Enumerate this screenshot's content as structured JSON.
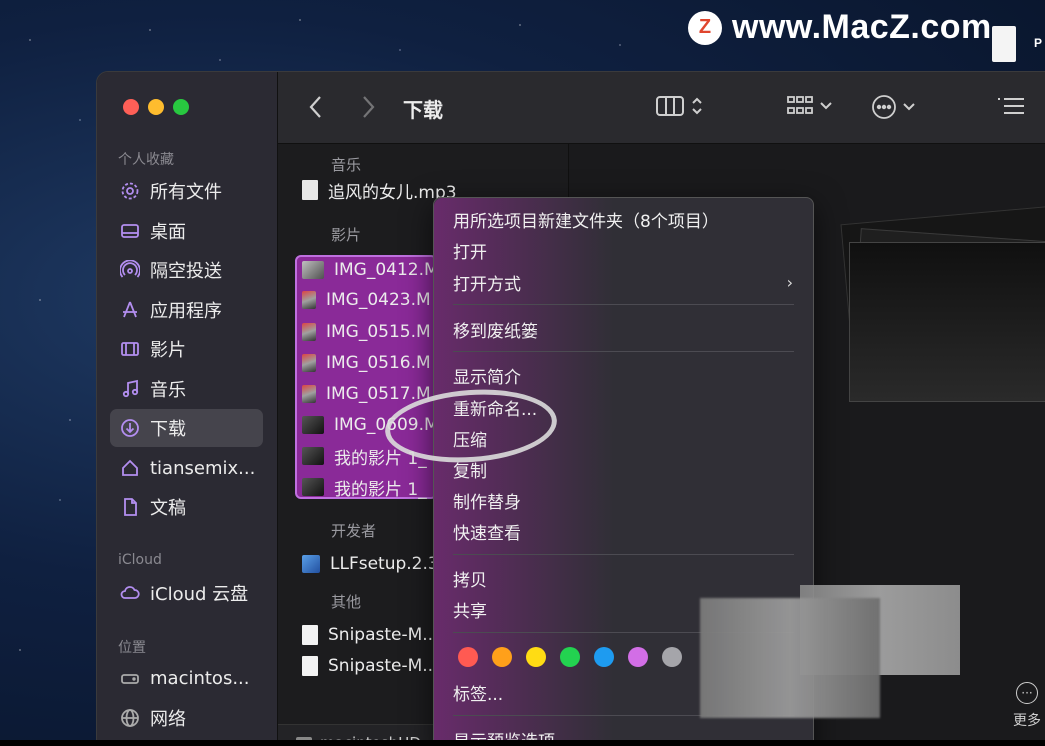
{
  "watermark": {
    "logo_letter": "Z",
    "text": "www.MacZ.com",
    "side_letter": "P"
  },
  "window": {
    "title": "下载",
    "toolbar_icons": [
      "chevron-left-icon",
      "chevron-right-icon",
      "column-view-icon",
      "group-icon",
      "more-options-icon",
      "list-icon"
    ]
  },
  "sidebar": {
    "sections": [
      {
        "label": "个人收藏"
      },
      {
        "label": "iCloud"
      },
      {
        "label": "位置"
      }
    ],
    "favorites": [
      {
        "label": "所有文件",
        "icon": "gear-icon"
      },
      {
        "label": "桌面",
        "icon": "desktop-icon"
      },
      {
        "label": "隔空投送",
        "icon": "airdrop-icon"
      },
      {
        "label": "应用程序",
        "icon": "apps-icon"
      },
      {
        "label": "影片",
        "icon": "film-icon"
      },
      {
        "label": "音乐",
        "icon": "music-icon"
      },
      {
        "label": "下载",
        "icon": "download-icon",
        "active": true
      },
      {
        "label": "tiansemix...",
        "icon": "home-icon"
      },
      {
        "label": "文稿",
        "icon": "document-icon"
      }
    ],
    "icloud": [
      {
        "label": "iCloud 云盘",
        "icon": "cloud-icon"
      }
    ],
    "locations": [
      {
        "label": "macintos...",
        "icon": "disk-icon"
      },
      {
        "label": "网络",
        "icon": "globe-icon"
      }
    ]
  },
  "filelist": {
    "groups": {
      "music": "音乐",
      "movies": "影片",
      "developer": "开发者",
      "other": "其他"
    },
    "music_files": [
      "追风的女儿.mp3"
    ],
    "movie_files": [
      "IMG_0412.M",
      "IMG_0423.M",
      "IMG_0515.M",
      "IMG_0516.M",
      "IMG_0517.M",
      "IMG_0609.M",
      "我的影片 1_",
      "我的影片 1_"
    ],
    "developer_files": [
      "LLFsetup.2.3"
    ],
    "other_files": [
      "Snipaste-M...",
      "Snipaste-M..."
    ],
    "pathbar": [
      "macintoshHD",
      "›"
    ]
  },
  "context_menu": {
    "items": [
      {
        "label": "用所选项目新建文件夹（8个项目）"
      },
      {
        "label": "打开"
      },
      {
        "label": "打开方式",
        "submenu": "›"
      },
      {
        "label": "移到废纸篓"
      },
      {
        "label": "显示简介"
      },
      {
        "label": "重新命名..."
      },
      {
        "label": "压缩"
      },
      {
        "label": "复制"
      },
      {
        "label": "制作替身"
      },
      {
        "label": "快速查看"
      },
      {
        "label": "拷贝"
      },
      {
        "label": "共享"
      },
      {
        "label": "标签..."
      },
      {
        "label": "显示预览选项"
      }
    ],
    "tag_colors": [
      "#ff5a52",
      "#ffa01a",
      "#ffdc14",
      "#23d250",
      "#1e9bf0",
      "#d26ee6",
      "#a5a5aa"
    ]
  },
  "preview": {
    "more_label": "更多"
  }
}
